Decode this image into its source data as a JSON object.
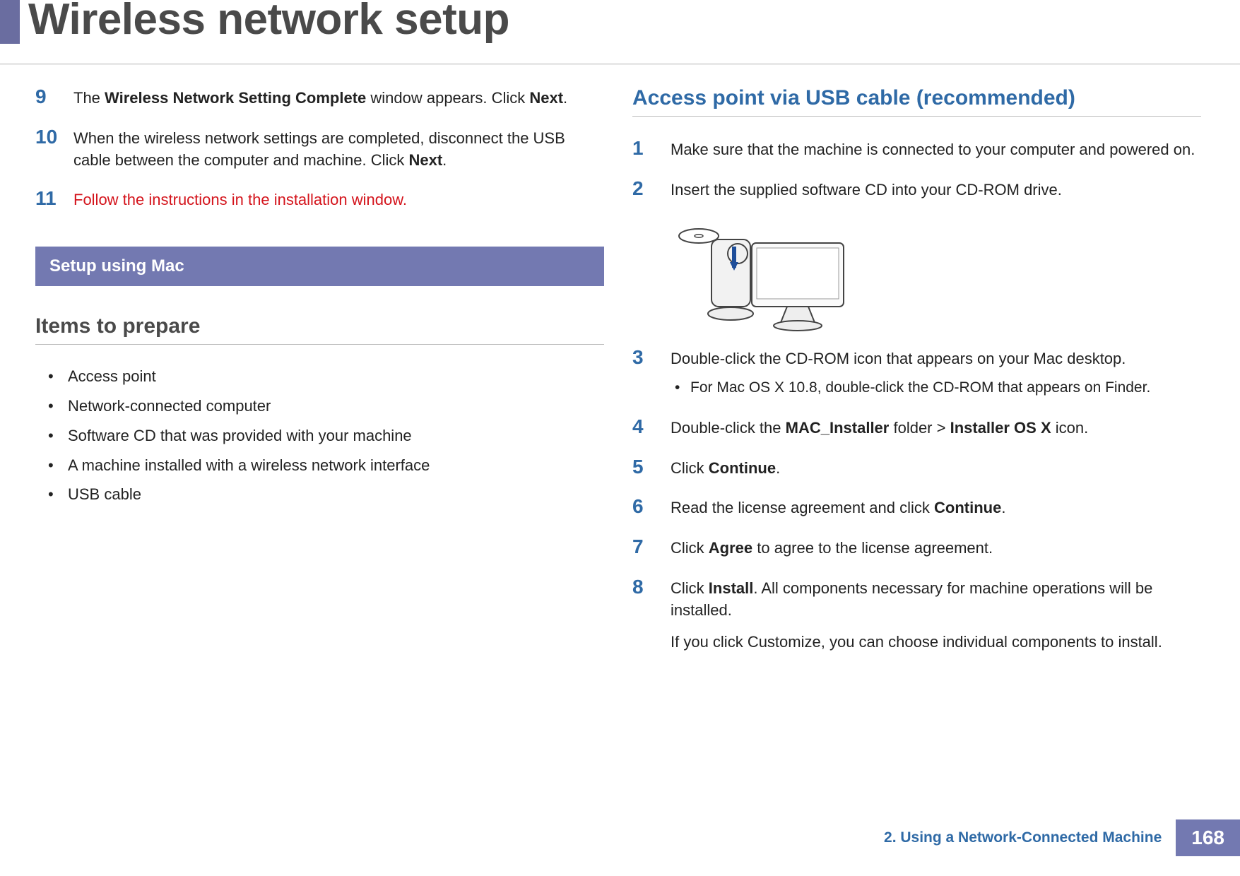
{
  "page_title": "Wireless network setup",
  "left": {
    "steps": [
      {
        "num": "9",
        "segments": [
          "The ",
          {
            "b": "Wireless Network Setting Complete"
          },
          " window appears. Click ",
          {
            "b": "Next"
          },
          "."
        ]
      },
      {
        "num": "10",
        "segments": [
          "When the wireless network settings are completed, disconnect the USB cable between the computer and machine. Click ",
          {
            "b": "Next"
          },
          "."
        ]
      },
      {
        "num": "11",
        "red": true,
        "segments": [
          "Follow the instructions in the installation window."
        ]
      }
    ],
    "section_bar": "Setup using Mac",
    "items_heading": "Items to prepare",
    "items": [
      "Access point",
      "Network-connected computer",
      "Software CD that was provided with your machine",
      "A machine installed with a wireless network interface",
      "USB cable"
    ]
  },
  "right": {
    "heading": "Access point via USB cable (recommended)",
    "steps": [
      {
        "num": "1",
        "segments": [
          "Make sure that the machine is connected to your computer and powered on."
        ]
      },
      {
        "num": "2",
        "segments": [
          "Insert the supplied software CD into your CD-ROM drive."
        ],
        "illustration": true
      },
      {
        "num": "3",
        "segments": [
          "Double-click the CD-ROM icon that appears on your Mac desktop."
        ],
        "sub": {
          "segments": [
            "For Mac OS X 10.8, double-click the CD-ROM that appears on ",
            {
              "b": "Finder"
            },
            "."
          ]
        }
      },
      {
        "num": "4",
        "segments": [
          "Double-click the ",
          {
            "b": "MAC_Installer"
          },
          " folder > ",
          {
            "b": "Installer OS X"
          },
          " icon."
        ]
      },
      {
        "num": "5",
        "segments": [
          "Click ",
          {
            "b": "Continue"
          },
          "."
        ]
      },
      {
        "num": "6",
        "segments": [
          "Read the license agreement and click ",
          {
            "b": "Continue"
          },
          "."
        ]
      },
      {
        "num": "7",
        "segments": [
          "Click ",
          {
            "b": "Agree"
          },
          " to agree to the license agreement."
        ]
      },
      {
        "num": "8",
        "segments": [
          "Click ",
          {
            "b": "Install"
          },
          ". All components necessary for machine operations will be installed."
        ],
        "extra": {
          "segments": [
            "If you click ",
            {
              "b": "Customize"
            },
            ", you can choose individual components to install."
          ]
        }
      }
    ]
  },
  "footer": {
    "chapter": "2.  Using a Network-Connected Machine",
    "page": "168"
  }
}
